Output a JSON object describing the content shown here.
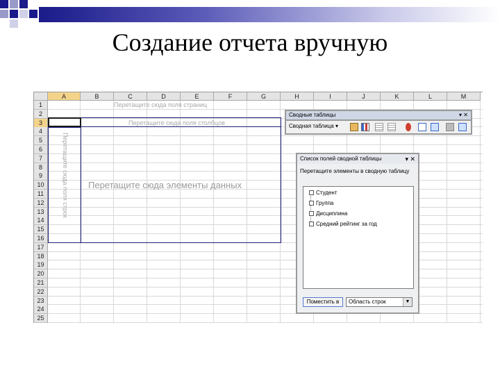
{
  "slide": {
    "title": "Создание отчета вручную"
  },
  "sheet": {
    "columns": [
      "A",
      "B",
      "C",
      "D",
      "E",
      "F",
      "G",
      "H",
      "I",
      "J",
      "K",
      "L",
      "M"
    ],
    "rows": [
      "1",
      "2",
      "3",
      "4",
      "5",
      "6",
      "7",
      "8",
      "9",
      "10",
      "11",
      "12",
      "13",
      "14",
      "15",
      "16",
      "17",
      "18",
      "19",
      "20",
      "21",
      "22",
      "23",
      "24",
      "25"
    ],
    "selected_column": "A",
    "selected_row": "3"
  },
  "pivot": {
    "page_drop": "Перетащите сюда поля страниц",
    "column_drop": "Перетащите сюда поля столбцов",
    "row_drop": "Перетащите сюда поля строк",
    "data_drop": "Перетащите сюда элементы данных"
  },
  "toolbar": {
    "title": "Сводные таблицы",
    "menu_label": "Сводная таблица ▾",
    "controls": "▾ ✕"
  },
  "field_list": {
    "title": "Список полей сводной таблицы",
    "controls": "▾ ✕",
    "instruction": "Перетащите элементы в сводную таблицу",
    "fields": [
      "Студент",
      "Группа",
      "Дисциплина",
      "Средний рейтинг за год"
    ],
    "add_button": "Поместить в",
    "area_select": "Область строк"
  },
  "colors": {
    "accent": "#1f1f7a",
    "selection": "#f3d38a"
  }
}
